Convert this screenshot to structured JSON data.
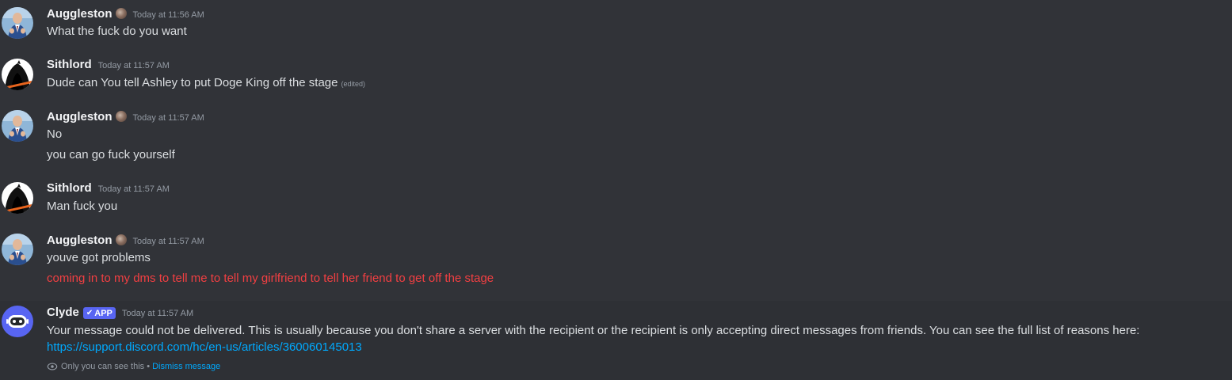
{
  "colors": {
    "background": "#313338",
    "username": "#f2f3f5",
    "message_text": "#dbdee1",
    "timestamp": "#949ba4",
    "failed_message": "#f23f42",
    "link": "#00a8fc",
    "app_badge": "#5865f2"
  },
  "messages": [
    {
      "author": "Auggleston",
      "avatar_icon": "user-avatar-suit",
      "timestamp": "Today at 11:56 AM",
      "lines": [
        "What the fuck do you want"
      ]
    },
    {
      "author": "Sithlord",
      "avatar_icon": "user-avatar-hooded-figure",
      "timestamp": "Today at 11:57 AM",
      "lines": [
        "Dude can You tell Ashley to put Doge King off the stage"
      ],
      "edited_label": "(edited)"
    },
    {
      "author": "Auggleston",
      "avatar_icon": "user-avatar-suit",
      "timestamp": "Today at 11:57 AM",
      "lines": [
        "No",
        "you can go fuck yourself"
      ]
    },
    {
      "author": "Sithlord",
      "avatar_icon": "user-avatar-hooded-figure",
      "timestamp": "Today at 11:57 AM",
      "lines": [
        "Man fuck you"
      ]
    },
    {
      "author": "Auggleston",
      "avatar_icon": "user-avatar-suit",
      "timestamp": "Today at 11:57 AM",
      "lines": [
        "youve got problems",
        "coming in to my dms to tell me to tell my girlfriend to tell her friend to get off the stage"
      ]
    }
  ],
  "clyde": {
    "author": "Clyde",
    "badge": "APP",
    "timestamp": "Today at 11:57 AM",
    "text": "Your message could not be delivered. This is usually because you don't share a server with the recipient or the recipient is only accepting direct messages from friends. You can see the full list of reasons here:",
    "link": "https://support.discord.com/hc/en-us/articles/360060145013",
    "ephemeral_note": "Only you can see this •",
    "dismiss_label": "Dismiss message"
  }
}
